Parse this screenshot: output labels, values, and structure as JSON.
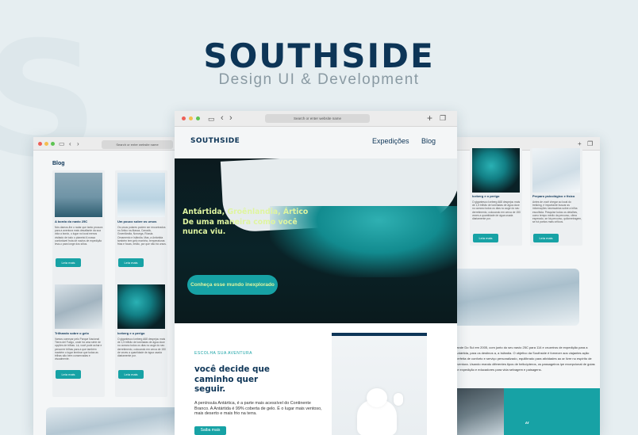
{
  "brand": {
    "title": "SOUTHSIDE",
    "subtitle": "Design UI & Development",
    "accent": "#17a2a5",
    "navy": "#0d3557"
  },
  "browser": {
    "url_placeholder": "Search or enter website name"
  },
  "site": {
    "logo": "SOUTHSIDE",
    "nav": [
      "Expedições",
      "Blog"
    ],
    "hero": {
      "headline": "Antártida, Groênlandia, Ártico De uma maneira como você nunca viu.",
      "cta": "Conheça esse mundo inexplorado"
    },
    "section": {
      "eyebrow": "ESCOLHA SUA AVENTURA",
      "heading": "você decide que caminho quer seguir.",
      "body": "A península Antártica, é a parte mais acessível do Continente Branco. A Antártida é 99% coberta de gelo. É o lugar mais ventoso, mais deserto e mais frio na terra.",
      "button": "Saiba mais"
    }
  },
  "blog": {
    "title": "Blog",
    "cards": [
      {
        "title": "A bordo do navio 25C",
        "text": "Nós damos-lhe o radar que tanto procura para a aventura mais desafiante da sua vida a bordo, o lugar no local menos visitado de todo o planeta! A nossa confortável frota de navios de expedição leva-o para longe dos sítios.",
        "button": "Leia mais"
      },
      {
        "title": "Um pouco sobre os ursos",
        "text": "Os ursos polares podem ser encontrados no Ártico na Alasca, Canadá, Groenlândia, Noruega, Rússia. Ornamento e Islândia. Mas, a Antártida também tem gelo marinho, temperaturas frias e focas, então, por que não há ursos.",
        "button": "Leia mais"
      },
      {
        "title": "Trilhando sobre o gelo",
        "text": "Vamos começar pelo Parque Nacional Tierra del Fuego, onde há uma série de opções de trilhas. Lá, você pode achar e percorrer trilhas para a que também mantém o lugar lembrar que todas as trilhas são bem conservadas e visualmente.",
        "button": "Leia mais"
      },
      {
        "title": "Iceberg e o perigo",
        "text": "O gigantesco Iceberg A68 despejou mais de 1,5 trilhão de toneladas de água doce no oceano todos os dias no auge do seu derretimento, colocando em cerca de 150 de vezes a quantidade de água usada diariamente por.",
        "button": "Leia mais"
      }
    ]
  },
  "right_panel": {
    "cards": [
      {
        "title": "Iceberg e o perigo",
        "text": "O gigantesco Iceberg A68 despejou mais de 1,5 trilhão de toneladas de água doce no oceano todos os dias no auge do seu derretimento, colocando em cerca de 150 vezes a quantidade de água usada diariamente por.",
        "button": "Leia mais"
      },
      {
        "title": "Preparo psicológico e físico",
        "text": "Antes de você chegar ao local do trekking, é importante buscar as informações necessárias sobre a trilha escolhida. Pesquise todos os detalhes, como tempo médio da percurso, clima esperado, se há percurso, quilometragem, se há pontos mais críticos.",
        "button": "Leia mais"
      }
    ],
    "about": "rande Do Sul em 2005, com junto do seu navio 25C para 114 e cruzeiros de expedição para a Antártida, para os destinos a, a Islândia. O objetivo da Southside é fornecer aos viajantes ação perfeita de conforto e serviço personalizado, equilibrado para atividades ao ar livre no espírito de aventura. Usando erando diferentes tipos de helicópteros, os passageiros ipe excepcional de guias de expedição e educadores para vida selvagem e paisagens."
  }
}
